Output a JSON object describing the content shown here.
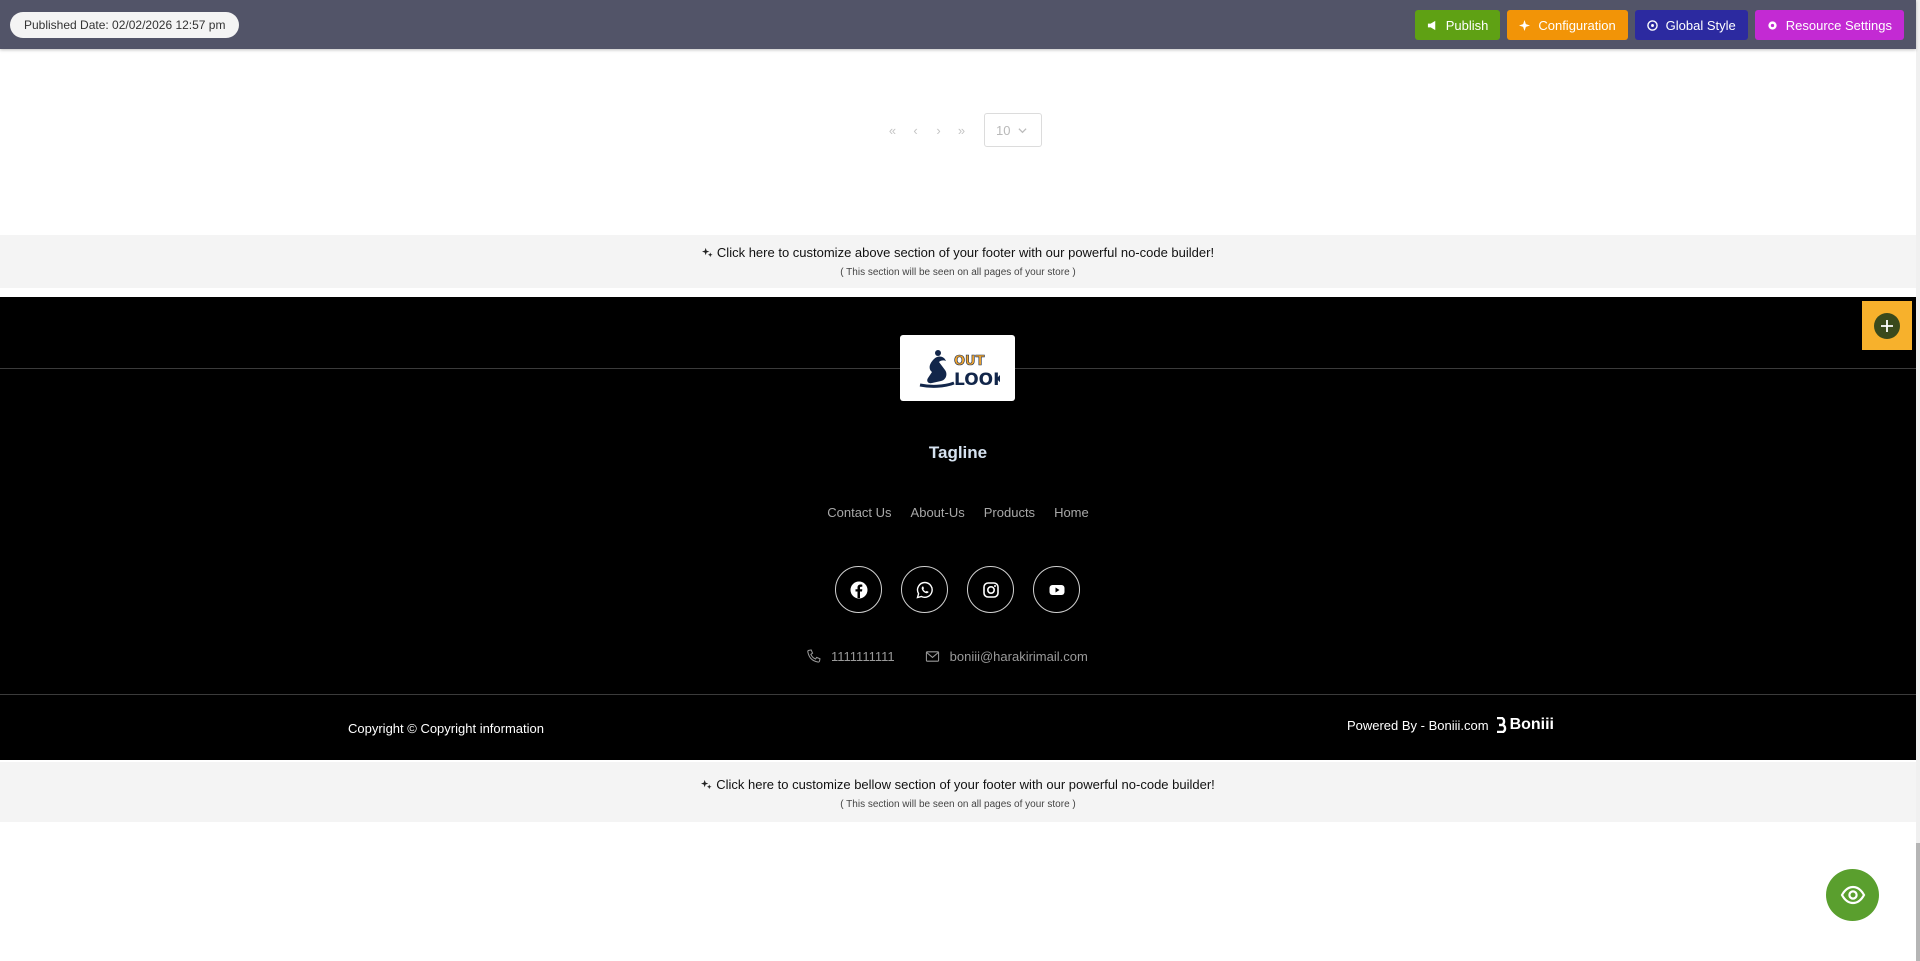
{
  "topbar": {
    "published_date": "Published Date: 02/02/2026 12:57 pm",
    "publish_label": "Publish",
    "configuration_label": "Configuration",
    "global_style_label": "Global Style",
    "resource_settings_label": "Resource Settings",
    "colors": {
      "bar": "#525468",
      "publish": "#5fa114",
      "configuration": "#f29407",
      "global_style": "#2c2aa0",
      "resource_settings": "#c32ad3"
    }
  },
  "pagination": {
    "first": "«",
    "prev": "‹",
    "next": "›",
    "last": "»",
    "page_size": "10"
  },
  "band_top": {
    "title": "Click here to customize above section of your footer with our powerful no-code builder!",
    "subtitle": "( This section will be seen on all pages of your store )"
  },
  "footer": {
    "tagline": "Tagline",
    "links": [
      "Contact Us",
      "About-Us",
      "Products",
      "Home"
    ],
    "socials": [
      "facebook-icon",
      "whatsapp-icon",
      "instagram-icon",
      "youtube-icon"
    ],
    "phone": "1111111111",
    "email": "boniii@harakirimail.com",
    "copyright": "Copyright © Copyright information",
    "powered_by": "Powered By - Boniii.com",
    "powered_logo": "Boniii",
    "colors": {
      "background": "#000000",
      "add_highlight": "#f7b12c"
    }
  },
  "band_bottom": {
    "title": "Click here to customize bellow section of your footer with our powerful no-code builder!",
    "subtitle": "( This section will be seen on all pages of your store )"
  },
  "preview": {
    "icon": "eye-icon",
    "color": "#5a9f2e"
  }
}
